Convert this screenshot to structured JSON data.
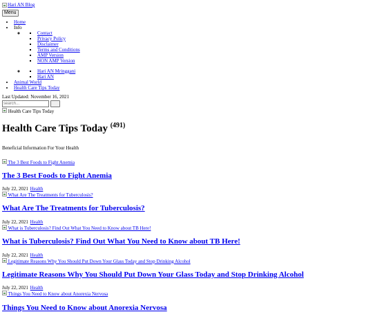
{
  "site": {
    "logo_alt": "Hari AN Blog"
  },
  "menu_button": "Menu",
  "nav": {
    "home": "Home",
    "info": "Info",
    "info_items": [
      "Contact",
      "Privacy Policy",
      "Disclaimer",
      "Terms and Conditions",
      "AMP Version",
      "NON AMP Version"
    ],
    "sub_items": [
      "Hari AN Mringgani",
      "Hari AN"
    ],
    "animal_world": "Animal World",
    "health_care": "Health Care Tips Today"
  },
  "last_updated": "Last Updated: November 16, 2021",
  "search": {
    "placeholder": "search..."
  },
  "category_image_alt": "Health Care Tips Today",
  "category_title": "Health Care Tips Today",
  "category_count": "(491)",
  "category_description": "Beneficial Information For Your Health",
  "posts": [
    {
      "thumb_alt": "The 3 Best Foods to Fight Anemia",
      "title": "The 3 Best Foods to Fight Anemia",
      "date": "July 22, 2021",
      "category": "Health"
    },
    {
      "thumb_alt": "What Are The Treatments for Tuberculosis?",
      "title": "What Are The Treatments for Tuberculosis?",
      "date": "July 22, 2021",
      "category": "Health"
    },
    {
      "thumb_alt": "What is Tuberculosis? Find Out What You Need to Know about TB Here!",
      "title": "What is Tuberculosis? Find Out What You Need to Know about TB Here!",
      "date": "July 22, 2021",
      "category": "Health"
    },
    {
      "thumb_alt": "Legitimate Reasons Why You Should Put Down Your Glass Today and Stop Drinking Alcohol",
      "title": "Legitimate Reasons Why You Should Put Down Your Glass Today and Stop Drinking Alcohol",
      "date": "July 22, 2021",
      "category": "Health"
    },
    {
      "thumb_alt": "Things You Need to Know about Anorexia Nervosa",
      "title": "Things You Need to Know about Anorexia Nervosa"
    }
  ]
}
